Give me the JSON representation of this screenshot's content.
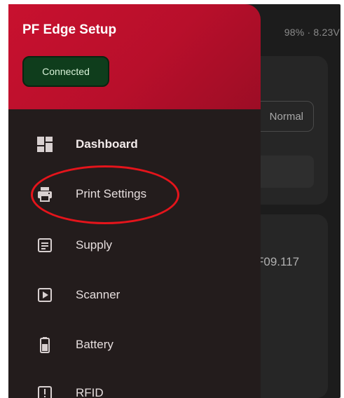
{
  "status": {
    "text": "98% · 8.23V"
  },
  "background": {
    "mode_chip": "Normal",
    "version_text": "F09.117"
  },
  "drawer": {
    "title": "PF Edge Setup",
    "connection_badge": "Connected",
    "items": [
      {
        "label": "Dashboard",
        "icon": "dashboard-icon",
        "active": true
      },
      {
        "label": "Print Settings",
        "icon": "printer-icon",
        "active": false
      },
      {
        "label": "Supply",
        "icon": "supply-icon",
        "active": false
      },
      {
        "label": "Scanner",
        "icon": "scanner-icon",
        "active": false
      },
      {
        "label": "Battery",
        "icon": "battery-icon",
        "active": false
      },
      {
        "label": "RFID",
        "icon": "rfid-icon",
        "active": false
      }
    ]
  },
  "colors": {
    "header_red": "#c8112f",
    "drawer_bg": "#231c1c",
    "badge_green": "#0f3d1c",
    "annotation_red": "#e4141b"
  }
}
